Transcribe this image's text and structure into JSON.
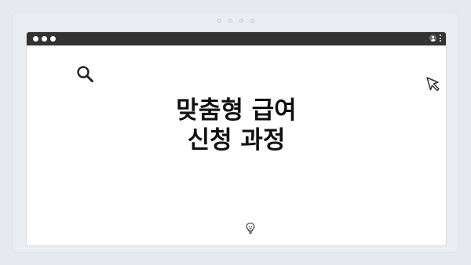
{
  "browser": {
    "traffic_lights": [
      "dot",
      "dot",
      "dot"
    ],
    "profile_icon": "user-avatar-icon",
    "menu_icon": "kebab-menu-icon",
    "frame_dots": [
      "dot",
      "dot",
      "dot",
      "dot"
    ]
  },
  "content": {
    "title_line1": "맞춤형 급여",
    "title_line2": "신청 과정",
    "icons": {
      "top_left": "search-icon",
      "top_right": "cursor-icon",
      "bottom": "lightbulb-icon"
    }
  },
  "colors": {
    "titlebar": "#333333",
    "background": "#e9ecf0",
    "text": "#111111"
  }
}
